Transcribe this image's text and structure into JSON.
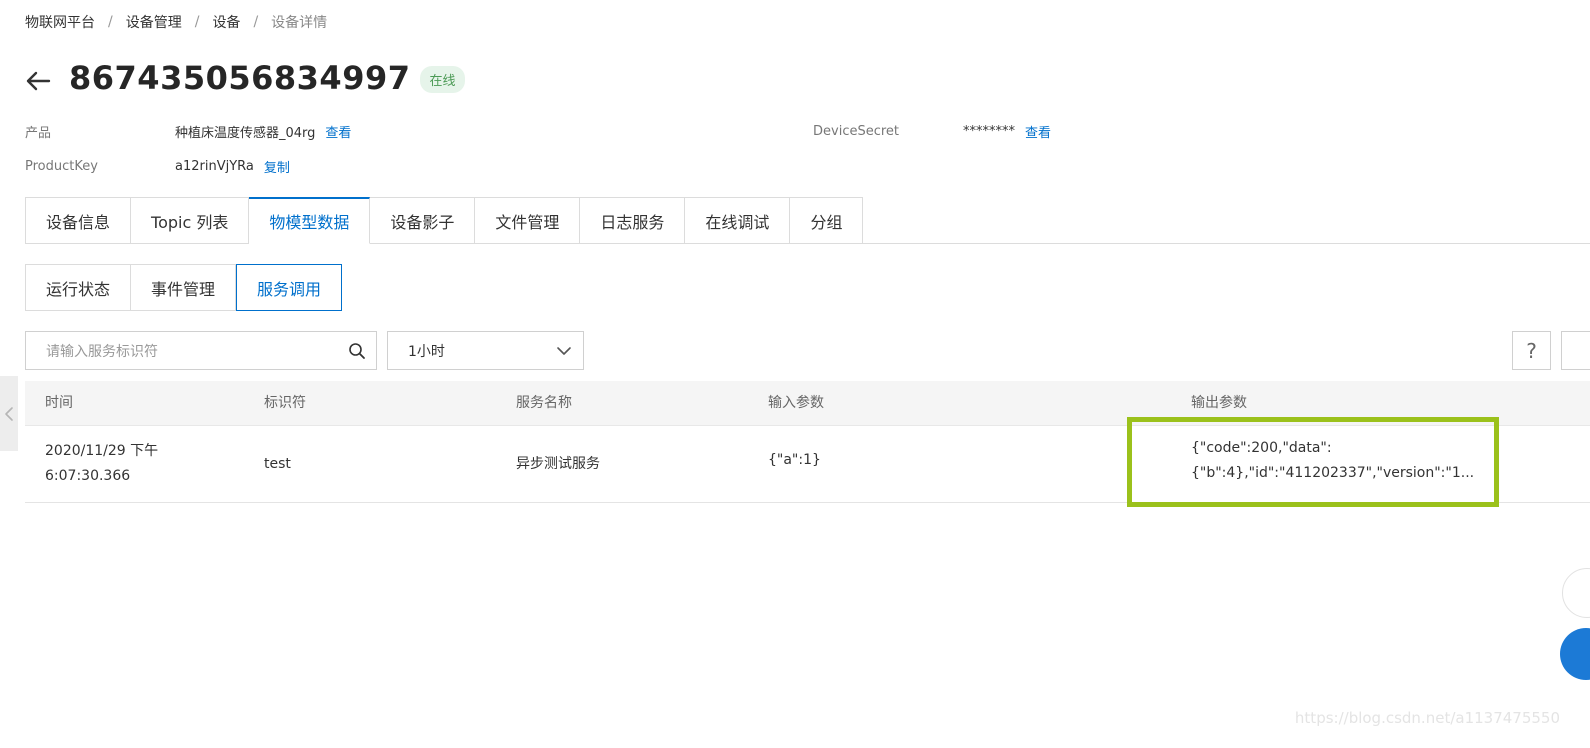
{
  "breadcrumb": {
    "items": [
      "物联网平台",
      "设备管理",
      "设备"
    ],
    "current": "设备详情",
    "separator": "/"
  },
  "header": {
    "title": "867435056834997",
    "status": "在线"
  },
  "meta": {
    "product_label": "产品",
    "product_value": "种植床温度传感器_04rg",
    "product_link": "查看",
    "productkey_label": "ProductKey",
    "productkey_value": "a12rinVjYRa",
    "productkey_link": "复制",
    "secret_label": "DeviceSecret",
    "secret_value": "********",
    "secret_link": "查看"
  },
  "tabs": [
    {
      "label": "设备信息"
    },
    {
      "label": "Topic 列表"
    },
    {
      "label": "物模型数据"
    },
    {
      "label": "设备影子"
    },
    {
      "label": "文件管理"
    },
    {
      "label": "日志服务"
    },
    {
      "label": "在线调试"
    },
    {
      "label": "分组"
    }
  ],
  "active_tab": "物模型数据",
  "subtabs": [
    {
      "label": "运行状态"
    },
    {
      "label": "事件管理"
    },
    {
      "label": "服务调用"
    }
  ],
  "active_subtab": "服务调用",
  "filters": {
    "search_placeholder": "请输入服务标识符",
    "time_range": "1小时"
  },
  "help": {
    "label": "?"
  },
  "table": {
    "columns": [
      "时间",
      "标识符",
      "服务名称",
      "输入参数",
      "输出参数"
    ],
    "rows": [
      {
        "time_line1": "2020/11/29 下午",
        "time_line2": "6:07:30.366",
        "identifier": "test",
        "service_name": "异步测试服务",
        "input": "{\"a\":1}",
        "output_line1": "{\"code\":200,\"data\":",
        "output_line2": "{\"b\":4},\"id\":\"411202337\",\"version\":\"1..."
      }
    ]
  },
  "watermark": "https://blog.csdn.net/a1137475550",
  "colors": {
    "accent": "#0070cc",
    "highlight": "#9bc11b",
    "status_bg": "#e6f4ea",
    "status_text": "#4b9a55"
  }
}
